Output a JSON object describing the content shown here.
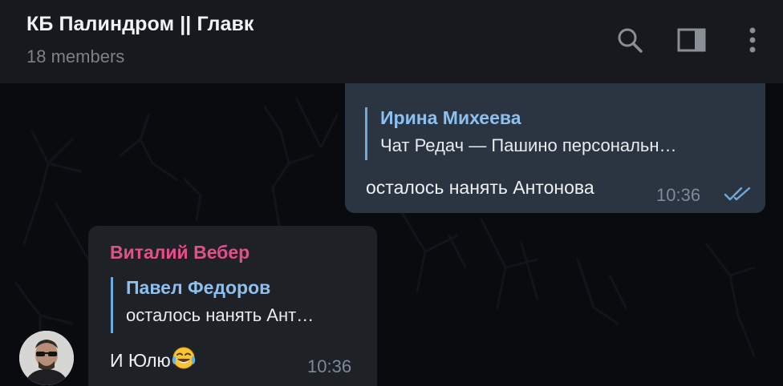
{
  "header": {
    "title": "КБ Палиндром || Главк",
    "members": "18 members",
    "icons": [
      "search-icon",
      "sidebar-toggle-icon",
      "more-vertical-icon"
    ]
  },
  "messages": [
    {
      "direction": "outgoing",
      "reply": {
        "name": "Ирина Михеева",
        "text": "Чат Редач — Пашино персональн…"
      },
      "text": "осталось нанять Антонова",
      "time": "10:36",
      "status": "read"
    },
    {
      "direction": "incoming",
      "sender": "Виталий Вебер",
      "reply": {
        "name": "Павел Федоров",
        "text": "осталось нанять Ант…"
      },
      "text": "И Юлю",
      "emoji": "face-with-tears-of-joy",
      "time": "10:36"
    }
  ],
  "colors": {
    "header_bg": "#17191e",
    "outgoing_bubble": "#2b3542",
    "incoming_bubble": "#1e2126",
    "reply_accent": "#6fa8dc",
    "sender_name": "#e64e8b",
    "read_ticks": "#6fa8dc"
  }
}
